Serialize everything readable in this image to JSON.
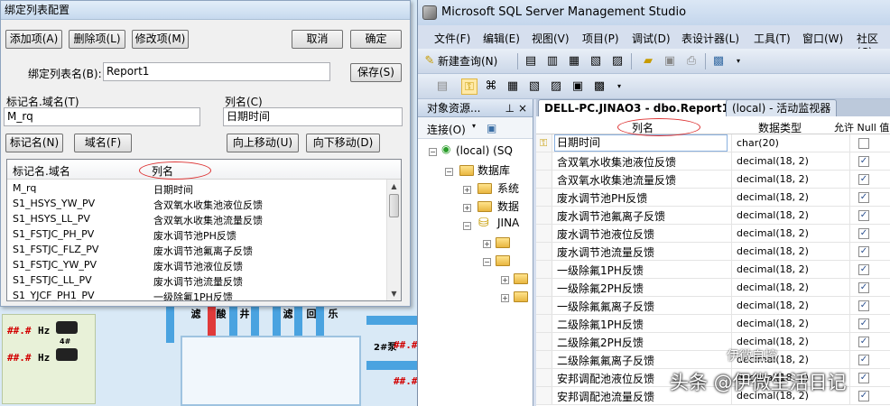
{
  "dialog": {
    "title": "绑定列表配置",
    "buttons": {
      "add": "添加项(A)",
      "delete": "删除项(L)",
      "modify": "修改项(M)",
      "cancel": "取消",
      "ok": "确定",
      "save": "保存(S)",
      "tag_name": "标记名(N)",
      "field": "域名(F)",
      "move_up": "向上移动(U)",
      "move_down": "向下移动(D)"
    },
    "list_name_label": "绑定列表名(B):",
    "list_name_value": "Report1",
    "tag_domain_label": "标记名.域名(T)",
    "tag_domain_value": "M_rq",
    "column_label": "列名(C)",
    "column_value": "日期时间",
    "list": {
      "headers": [
        "标记名.域名",
        "列名"
      ],
      "rows": [
        [
          "M_rq",
          "日期时间"
        ],
        [
          "S1_HSYS_YW_PV",
          "含双氧水收集池液位反馈"
        ],
        [
          "S1_HSYS_LL_PV",
          "含双氧水收集池流量反馈"
        ],
        [
          "S1_FSTJC_PH_PV",
          "废水调节池PH反馈"
        ],
        [
          "S1_FSTJC_FLZ_PV",
          "废水调节池氟离子反馈"
        ],
        [
          "S1_FSTJC_YW_PV",
          "废水调节池液位反馈"
        ],
        [
          "S1_FSTJC_LL_PV",
          "废水调节池流量反馈"
        ],
        [
          "S1_YJCF_PH1_PV",
          "一级除氟1PH反馈"
        ]
      ]
    }
  },
  "ssms": {
    "title": "Microsoft SQL Server Management Studio",
    "menu": [
      "文件(F)",
      "编辑(E)",
      "视图(V)",
      "项目(P)",
      "调试(D)",
      "表设计器(L)",
      "工具(T)",
      "窗口(W)",
      "社区(C)"
    ],
    "toolbar_new_query": "新建查询(N)",
    "object_explorer": {
      "title": "对象资源...",
      "connect": "连接(O)",
      "nodes": {
        "server": "(local) (SQ",
        "databases": "数据库",
        "system": "系统",
        "snapshots": "数据",
        "jinao": "JINA"
      }
    },
    "tabs": {
      "active": "DELL-PC.JINAO3 - dbo.Report1",
      "inactive": "(local) - 活动监视器"
    },
    "grid": {
      "headers": [
        "列名",
        "数据类型",
        "允许 Null 值"
      ],
      "rows": [
        {
          "name": "日期时间",
          "type": "char(20)",
          "null": false
        },
        {
          "name": "含双氧水收集池液位反馈",
          "type": "decimal(18, 2)",
          "null": true
        },
        {
          "name": "含双氧水收集池流量反馈",
          "type": "decimal(18, 2)",
          "null": true
        },
        {
          "name": "废水调节池PH反馈",
          "type": "decimal(18, 2)",
          "null": true
        },
        {
          "name": "废水调节池氟离子反馈",
          "type": "decimal(18, 2)",
          "null": true
        },
        {
          "name": "废水调节池液位反馈",
          "type": "decimal(18, 2)",
          "null": true
        },
        {
          "name": "废水调节池流量反馈",
          "type": "decimal(18, 2)",
          "null": true
        },
        {
          "name": "一级除氟1PH反馈",
          "type": "decimal(18, 2)",
          "null": true
        },
        {
          "name": "一级除氟2PH反馈",
          "type": "decimal(18, 2)",
          "null": true
        },
        {
          "name": "一级除氟氟离子反馈",
          "type": "decimal(18, 2)",
          "null": true
        },
        {
          "name": "二级除氟1PH反馈",
          "type": "decimal(18, 2)",
          "null": true
        },
        {
          "name": "二级除氟2PH反馈",
          "type": "decimal(18, 2)",
          "null": true
        },
        {
          "name": "二级除氟氟离子反馈",
          "type": "decimal(18, 2)",
          "null": true
        },
        {
          "name": "安邦调配池液位反馈",
          "type": "decimal(18, 2)",
          "null": true
        },
        {
          "name": "安邦调配池流量反馈",
          "type": "decimal(18, 2)",
          "null": true
        }
      ]
    }
  },
  "scada": {
    "alarm": "##.#",
    "hz": "Hz",
    "pump_num": "4#",
    "pump_label": "2#泵",
    "vertical_labels": [
      "滤",
      "酸",
      "井",
      "滤",
      "回",
      "乐"
    ]
  },
  "watermark": {
    "text": "头条 @伊微生活日记",
    "logo": "伊微自控"
  },
  "colors": {
    "accent": "#3a6ea5",
    "annotation": "#dd3333",
    "alarm": "#d20000",
    "pipe": "#4aa3e0"
  }
}
